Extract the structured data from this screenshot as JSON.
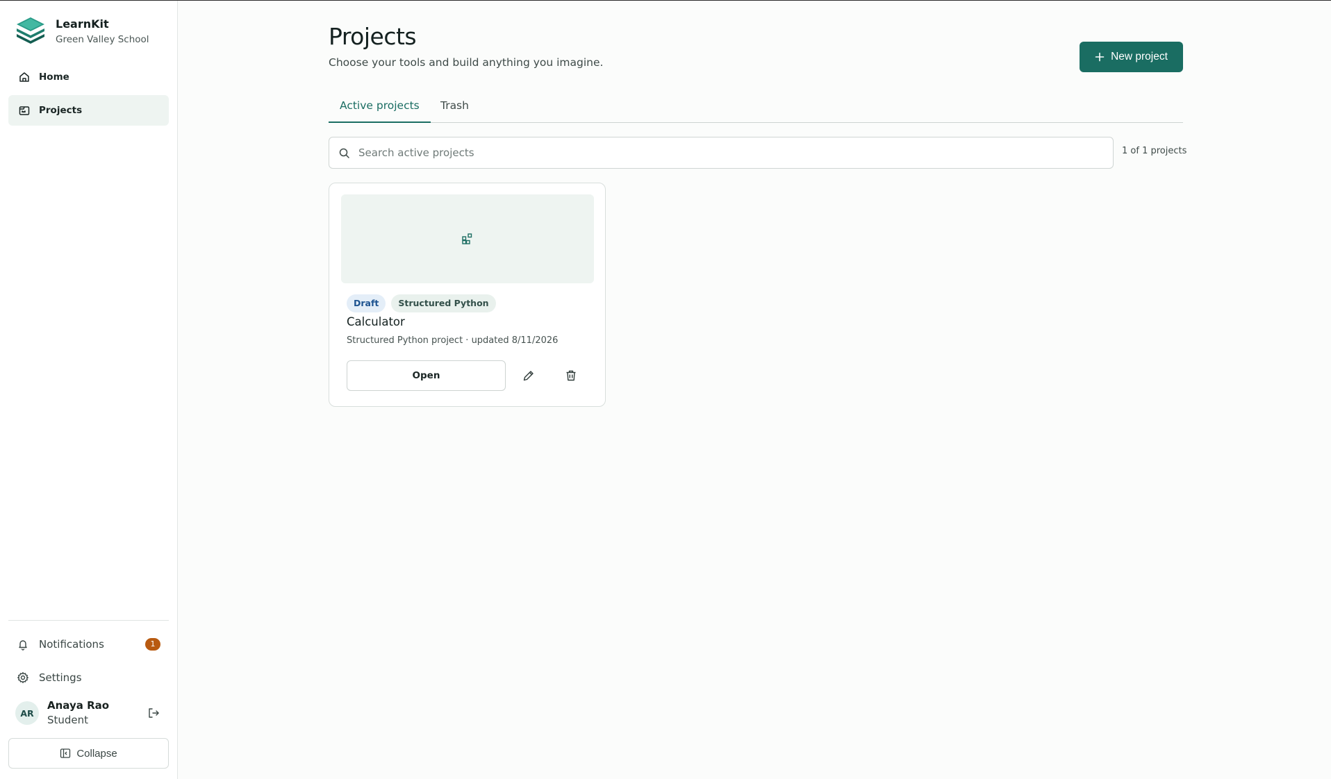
{
  "brand": {
    "name": "LearnKit",
    "school": "Green Valley School",
    "logo_icon": "stacked-layers-logo"
  },
  "sidebar": {
    "items": [
      {
        "label": "Home",
        "icon": "home-icon",
        "active": false
      },
      {
        "label": "Projects",
        "icon": "projects-icon",
        "active": true
      }
    ],
    "notifications": {
      "label": "Notifications",
      "count": "1"
    },
    "settings": {
      "label": "Settings"
    },
    "user": {
      "initials": "AR",
      "name": "Anaya Rao",
      "role": "Student"
    },
    "collapse_label": "Collapse"
  },
  "header": {
    "title": "Projects",
    "subtitle": "Choose your tools and build anything you imagine.",
    "new_button_label": "New project"
  },
  "tabs": [
    {
      "label": "Active projects",
      "active": true
    },
    {
      "label": "Trash",
      "active": false
    }
  ],
  "search": {
    "placeholder": "Search active projects",
    "value": ""
  },
  "result_count": "1 of 1 projects",
  "projects": [
    {
      "status": "Draft",
      "type": "Structured Python",
      "title": "Calculator",
      "meta": "Structured Python project · updated 8/11/2026",
      "open_label": "Open"
    }
  ],
  "colors": {
    "accent": "#1a6d62",
    "badge": "#b85a10",
    "active_nav_bg": "#eef4f1",
    "draft_tag_bg": "#e4eef8",
    "draft_tag_text": "#1d5390"
  }
}
